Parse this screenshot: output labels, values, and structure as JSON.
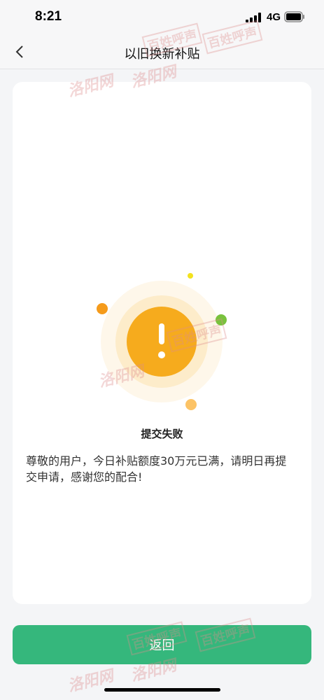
{
  "status": {
    "time": "8:21",
    "network": "4G"
  },
  "nav": {
    "title": "以旧换新补贴"
  },
  "result": {
    "title": "提交失败",
    "message": "尊敬的用户，今日补贴额度30万元已满，请明日再提交申请，感谢您的配合!"
  },
  "actions": {
    "return_label": "返回"
  },
  "watermark": {
    "text_a": "洛阳网",
    "text_b": "百姓呼声"
  },
  "colors": {
    "accent_green": "#35b77c",
    "warning_orange": "#f6ab1d",
    "dot_green": "#79c23d",
    "dot_yellow": "#f3e21e"
  }
}
